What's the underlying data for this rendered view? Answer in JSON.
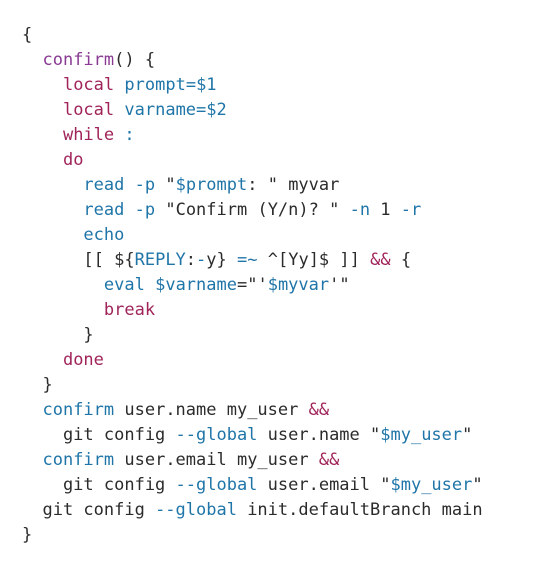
{
  "code": {
    "language": "bash",
    "lines": [
      [
        {
          "text": "{",
          "type": "text"
        }
      ],
      [
        {
          "text": "  ",
          "type": "text"
        },
        {
          "text": "confirm",
          "type": "func"
        },
        {
          "text": "() {",
          "type": "text"
        }
      ],
      [
        {
          "text": "    ",
          "type": "text"
        },
        {
          "text": "local",
          "type": "keyword"
        },
        {
          "text": " ",
          "type": "text"
        },
        {
          "text": "prompt",
          "type": "variable"
        },
        {
          "text": "=",
          "type": "operator"
        },
        {
          "text": "$1",
          "type": "variable"
        }
      ],
      [
        {
          "text": "    ",
          "type": "text"
        },
        {
          "text": "local",
          "type": "keyword"
        },
        {
          "text": " ",
          "type": "text"
        },
        {
          "text": "varname",
          "type": "variable"
        },
        {
          "text": "=",
          "type": "operator"
        },
        {
          "text": "$2",
          "type": "variable"
        }
      ],
      [
        {
          "text": "    ",
          "type": "text"
        },
        {
          "text": "while",
          "type": "keyword"
        },
        {
          "text": " ",
          "type": "text"
        },
        {
          "text": ":",
          "type": "builtin"
        }
      ],
      [
        {
          "text": "    ",
          "type": "text"
        },
        {
          "text": "do",
          "type": "keyword"
        }
      ],
      [
        {
          "text": "      ",
          "type": "text"
        },
        {
          "text": "read",
          "type": "builtin"
        },
        {
          "text": " ",
          "type": "text"
        },
        {
          "text": "-p",
          "type": "option"
        },
        {
          "text": " \"",
          "type": "string"
        },
        {
          "text": "$prompt",
          "type": "variable"
        },
        {
          "text": ": \" myvar",
          "type": "string"
        }
      ],
      [
        {
          "text": "      ",
          "type": "text"
        },
        {
          "text": "read",
          "type": "builtin"
        },
        {
          "text": " ",
          "type": "text"
        },
        {
          "text": "-p",
          "type": "option"
        },
        {
          "text": " \"Confirm (Y/n)? \" ",
          "type": "string"
        },
        {
          "text": "-n",
          "type": "option"
        },
        {
          "text": " 1 ",
          "type": "text"
        },
        {
          "text": "-r",
          "type": "option"
        }
      ],
      [
        {
          "text": "      ",
          "type": "text"
        },
        {
          "text": "echo",
          "type": "builtin"
        }
      ],
      [
        {
          "text": "      [[ ",
          "type": "text"
        },
        {
          "text": "${",
          "type": "text"
        },
        {
          "text": "REPLY",
          "type": "variable"
        },
        {
          "text": ":",
          "type": "text"
        },
        {
          "text": "-",
          "type": "option"
        },
        {
          "text": "y}",
          "type": "text"
        },
        {
          "text": " ",
          "type": "text"
        },
        {
          "text": "=~",
          "type": "operator"
        },
        {
          "text": " ^[Yy]$ ]] ",
          "type": "text"
        },
        {
          "text": "&&",
          "type": "keyword"
        },
        {
          "text": " {",
          "type": "text"
        }
      ],
      [
        {
          "text": "        ",
          "type": "text"
        },
        {
          "text": "eval",
          "type": "builtin"
        },
        {
          "text": " ",
          "type": "text"
        },
        {
          "text": "$varname",
          "type": "variable"
        },
        {
          "text": "=\"'",
          "type": "string"
        },
        {
          "text": "$myvar",
          "type": "variable"
        },
        {
          "text": "'\"",
          "type": "string"
        }
      ],
      [
        {
          "text": "        ",
          "type": "text"
        },
        {
          "text": "break",
          "type": "keyword"
        }
      ],
      [
        {
          "text": "      }",
          "type": "text"
        }
      ],
      [
        {
          "text": "    ",
          "type": "text"
        },
        {
          "text": "done",
          "type": "keyword"
        }
      ],
      [
        {
          "text": "  }",
          "type": "text"
        }
      ],
      [
        {
          "text": "  ",
          "type": "text"
        },
        {
          "text": "confirm",
          "type": "builtin"
        },
        {
          "text": " user.name my_user ",
          "type": "text"
        },
        {
          "text": "&&",
          "type": "keyword"
        }
      ],
      [
        {
          "text": "    git config ",
          "type": "text"
        },
        {
          "text": "--global",
          "type": "option"
        },
        {
          "text": " user.name \"",
          "type": "string"
        },
        {
          "text": "$my_user",
          "type": "variable"
        },
        {
          "text": "\"",
          "type": "string"
        }
      ],
      [
        {
          "text": "  ",
          "type": "text"
        },
        {
          "text": "confirm",
          "type": "builtin"
        },
        {
          "text": " user.email my_user ",
          "type": "text"
        },
        {
          "text": "&&",
          "type": "keyword"
        }
      ],
      [
        {
          "text": "    git config ",
          "type": "text"
        },
        {
          "text": "--global",
          "type": "option"
        },
        {
          "text": " user.email \"",
          "type": "string"
        },
        {
          "text": "$my_user",
          "type": "variable"
        },
        {
          "text": "\"",
          "type": "string"
        }
      ],
      [
        {
          "text": "  git config ",
          "type": "text"
        },
        {
          "text": "--global",
          "type": "option"
        },
        {
          "text": " init.defaultBranch main",
          "type": "text"
        }
      ],
      [
        {
          "text": "}",
          "type": "text"
        }
      ]
    ]
  },
  "colors": {
    "background": "#ffffff",
    "text": "#2b2b2b",
    "keyword": "#a0245a",
    "function": "#8a3a93",
    "variable": "#1f75a8"
  }
}
